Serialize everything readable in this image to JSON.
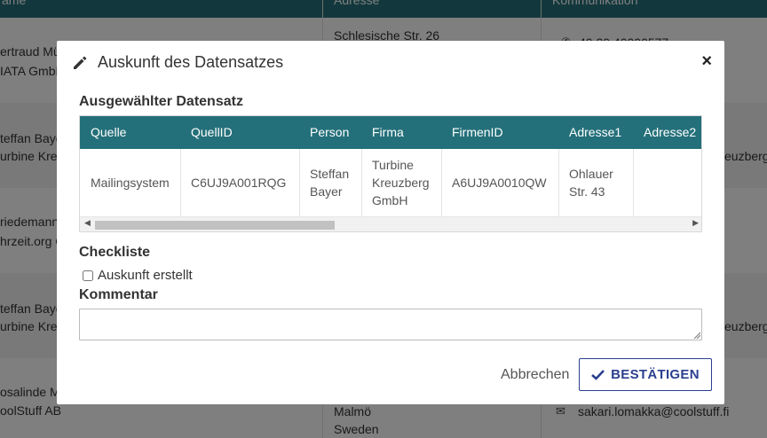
{
  "background": {
    "headers": [
      "ame",
      "Adresse",
      "Kommunikation"
    ],
    "rows": [
      {
        "name1": "ertraud Mü",
        "name2": "IATA GmbH",
        "addr1": "Schlesische Str. 26",
        "comm": "40 20 40000577"
      },
      {
        "name1": "teffan Baye",
        "name2": "urbine Kreuz",
        "comm": "euzberg."
      },
      {
        "name1": "riedemann",
        "name2": "hrzeit.org G"
      },
      {
        "name1": "teffan Baye",
        "name2": "urbine Kreuz",
        "comm": "euzberg."
      },
      {
        "name1": "osalinde M",
        "name2": "oolStuff AB",
        "addr1": "Malmö",
        "addr2": "Sweden",
        "comm": "sakari.lomakka@coolstuff.fi"
      }
    ]
  },
  "modal": {
    "title": "Auskunft des Datensatzes",
    "close_label": "×",
    "selected_heading": "Ausgewählter Datensatz",
    "grid": {
      "columns": [
        "Quelle",
        "QuellID",
        "Person",
        "Firma",
        "FirmenID",
        "Adresse1",
        "Adresse2"
      ],
      "row": [
        "Mailingsystem",
        "C6UJ9A001RQG",
        "Steffan Bayer",
        "Turbine Kreuzberg GmbH",
        "A6UJ9A0010QW",
        "Ohlauer Str. 43",
        ""
      ]
    },
    "checklist_heading": "Checkliste",
    "checkbox_label": "Auskunft erstellt",
    "checkbox_checked": false,
    "comment_heading": "Kommentar",
    "comment_value": "",
    "cancel_label": "Abbrechen",
    "confirm_label": "BESTÄTIGEN"
  },
  "colors": {
    "header_teal": "#24707a",
    "confirm_blue": "#2b3f8f"
  }
}
